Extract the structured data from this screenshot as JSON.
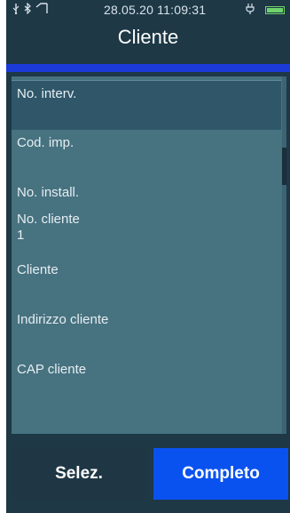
{
  "statusbar": {
    "datetime": "28.05.20 11:09:31",
    "left_icons": [
      "usb-icon",
      "bluetooth-icon",
      "signal-icon"
    ],
    "right_icons": [
      "plug-icon",
      "battery-icon"
    ],
    "battery_color": "#6fd36b"
  },
  "title": "Cliente",
  "list": {
    "rows": [
      {
        "label": "No. interv.",
        "value": "",
        "selected": true
      },
      {
        "label": "Cod. imp.",
        "value": ""
      },
      {
        "label": "No. install.",
        "value": ""
      },
      {
        "label": "No. cliente",
        "value": "1"
      },
      {
        "label": "Cliente",
        "value": ""
      },
      {
        "label": "Indirizzo cliente",
        "value": ""
      },
      {
        "label": "CAP cliente",
        "value": ""
      }
    ]
  },
  "buttons": {
    "selez_label": "Selez.",
    "completo_label": "Completo"
  },
  "colors": {
    "background": "#1e3846",
    "accent_bar": "#1b3ad8",
    "list_bg": "#477280",
    "selected_row": "#2f5769",
    "primary_button": "#0a52f0"
  }
}
